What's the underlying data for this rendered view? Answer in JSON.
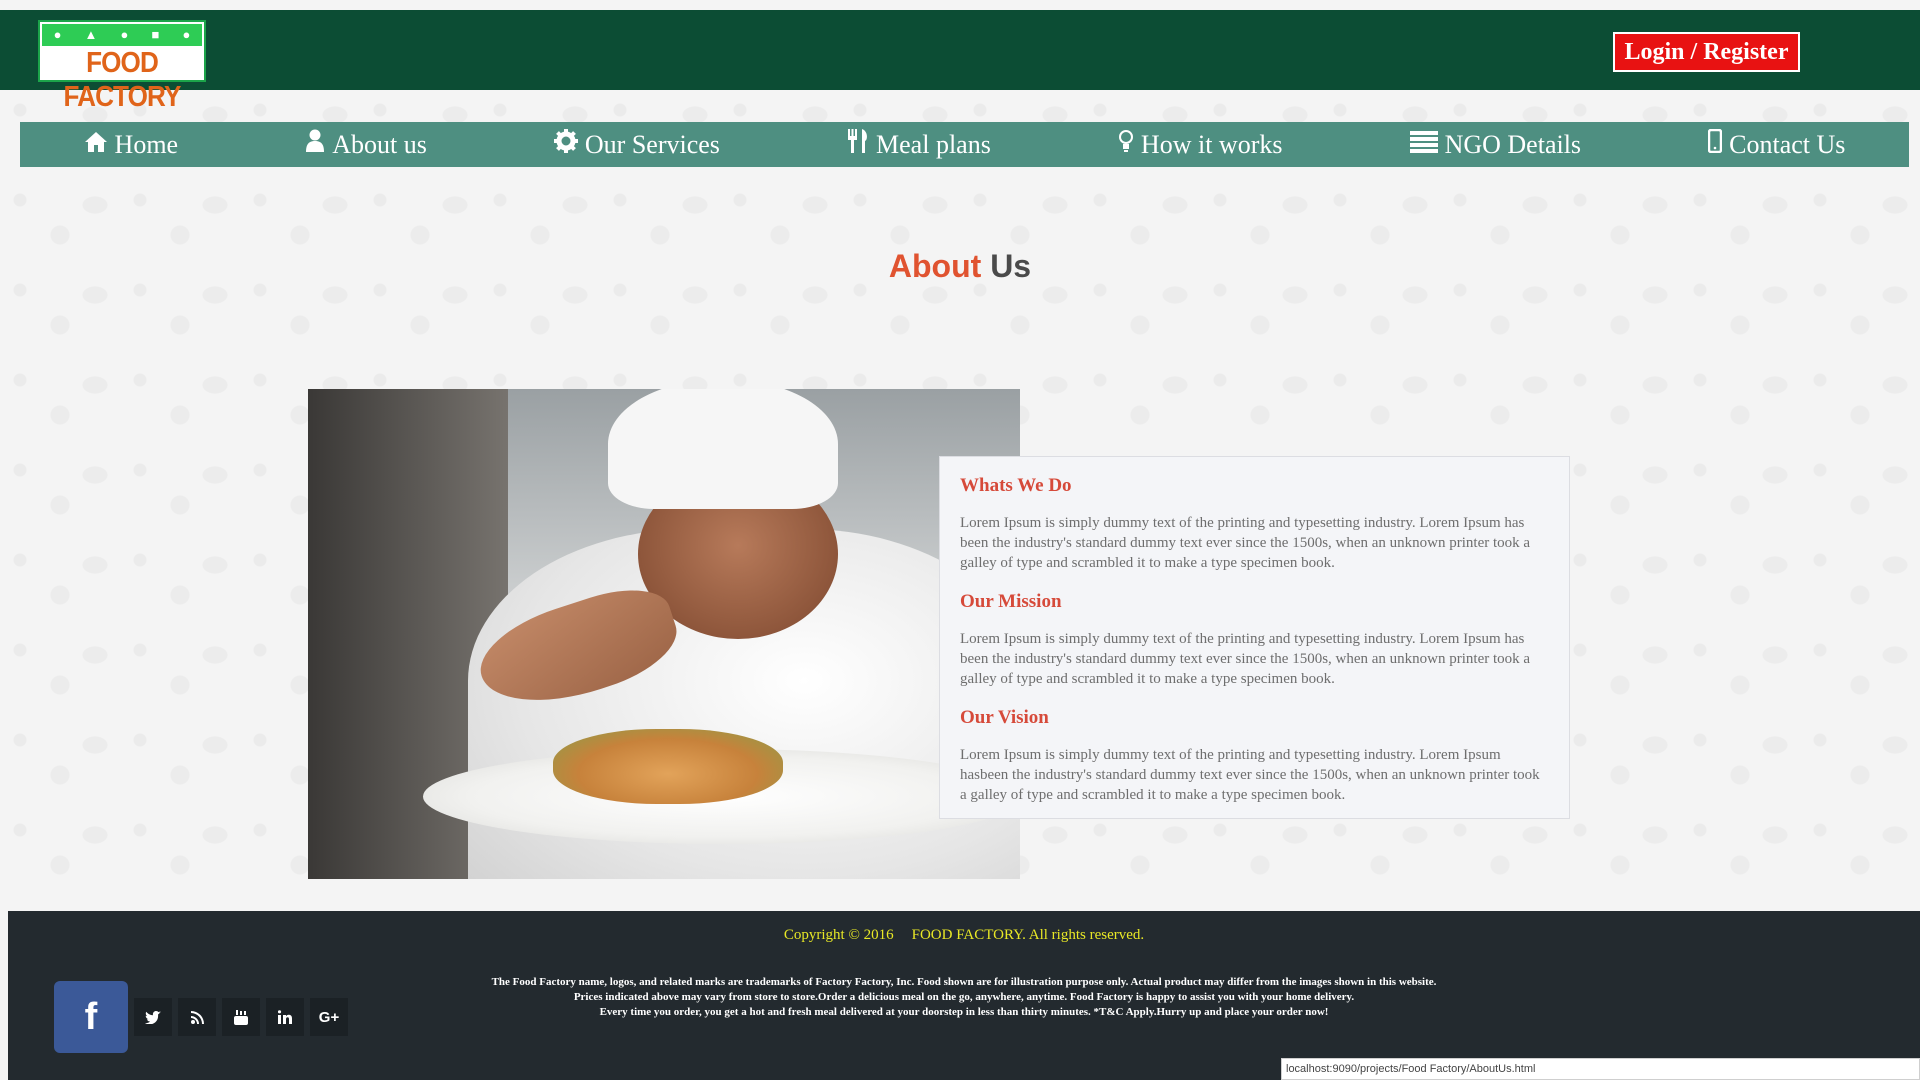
{
  "header": {
    "logo_text": "FOOD FACTORY",
    "login_label": "Login / Register"
  },
  "nav": {
    "items": [
      {
        "label": "Home",
        "icon": "home-icon"
      },
      {
        "label": "About us",
        "icon": "user-icon"
      },
      {
        "label": "Our Services",
        "icon": "gear-icon"
      },
      {
        "label": "Meal plans",
        "icon": "cutlery-icon"
      },
      {
        "label": "How it works",
        "icon": "lightbulb-icon"
      },
      {
        "label": "NGO Details",
        "icon": "list-icon"
      },
      {
        "label": "Contact Us",
        "icon": "mobile-icon"
      }
    ]
  },
  "main": {
    "title_part1": "About",
    "title_part2": "Us",
    "sections": [
      {
        "heading": "Whats We Do",
        "text": "Lorem Ipsum is simply dummy text of the printing and typesetting industry. Lorem Ipsum has been the industry's standard dummy text ever since the 1500s, when an unknown printer took a galley of type and scrambled it to make a type specimen book."
      },
      {
        "heading": "Our Mission",
        "text": "Lorem Ipsum is simply dummy text of the printing and typesetting industry. Lorem Ipsum has been the industry's standard dummy text ever since the 1500s, when an unknown printer took a galley of type and scrambled it to make a type specimen book."
      },
      {
        "heading": "Our Vision",
        "text": "Lorem Ipsum is simply dummy text of the printing and typesetting industry. Lorem Ipsum hasbeen the industry's standard dummy text ever since the 1500s, when an unknown printer took a galley of type and scrambled it to make a type specimen book."
      }
    ]
  },
  "footer": {
    "copyright_left": "Copyright © 2016",
    "copyright_right": "FOOD FACTORY. All rights reserved.",
    "fine_line1": "The Food Factory name, logos, and related marks are trademarks of Factory Factory, Inc. Food shown are for illustration purpose only. Actual product may differ from the images shown in this website.",
    "fine_line2": "Prices indicated above may vary from store to store.Order a delicious meal on the go, anywhere, anytime. Food Factory is happy to assist you with your home delivery.",
    "fine_line3": "Every time you order, you get a hot and fresh meal delivered at your doorstep in less than thirty minutes. *T&C Apply.Hurry up and place your order now!",
    "social": {
      "facebook": "f",
      "googleplus": "G+"
    },
    "social_icons": [
      "facebook-icon",
      "twitter-icon",
      "rss-icon",
      "youtube-icon",
      "linkedin-icon",
      "google-plus-icon"
    ]
  },
  "status_bar": {
    "url": "localhost:9090/projects/Food Factory/AboutUs.html"
  },
  "colors": {
    "header_bg": "#0c4d34",
    "nav_bg": "#4e8f81",
    "accent_red": "#e05330",
    "login_bg": "#e81212",
    "footer_bg": "#232a2f",
    "copyright": "#e8e826",
    "facebook": "#3b5998"
  }
}
